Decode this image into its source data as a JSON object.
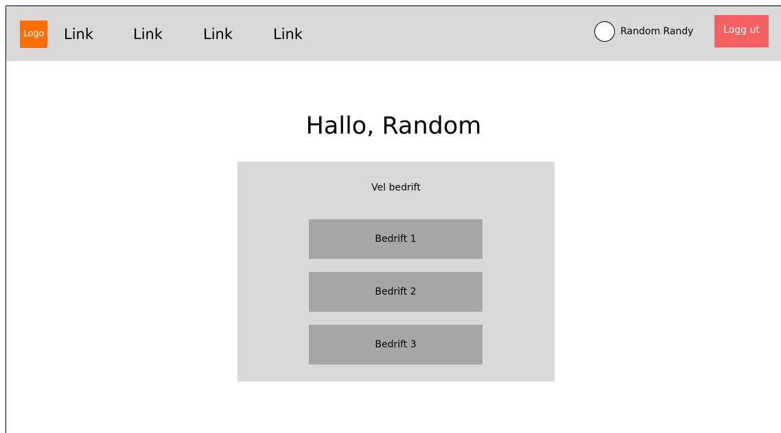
{
  "navbar": {
    "logo_text": "Logo",
    "links": [
      "Link",
      "Link",
      "Link",
      "Link"
    ],
    "user_name": "Random Randy",
    "logout_label": "Logg ut"
  },
  "main": {
    "greeting": "Hallo, Random",
    "panel_title": "Vel bedrift",
    "companies": [
      "Bedrift 1",
      "Bedrift 2",
      "Bedrift 3"
    ]
  },
  "colors": {
    "navbar_bg": "#d9d9d9",
    "logo_bg": "#ff6d00",
    "logout_bg": "#f45f5f",
    "panel_bg": "#d9d9d9",
    "company_button_bg": "#a6a6a6"
  }
}
